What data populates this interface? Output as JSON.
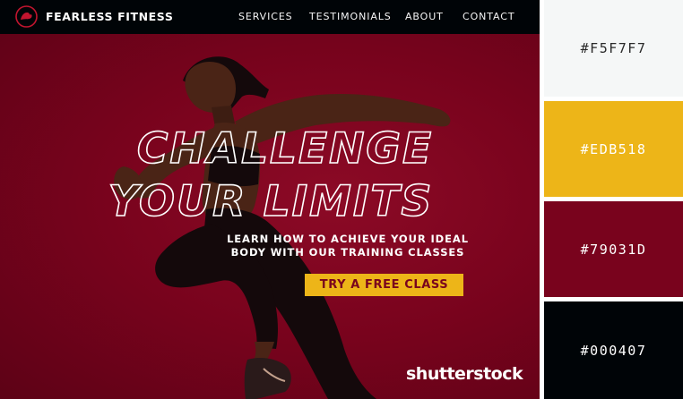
{
  "brand": {
    "name": "FEARLESS FITNESS"
  },
  "nav": {
    "items": [
      {
        "label": "SERVICES"
      },
      {
        "label": "TESTIMONIALS"
      },
      {
        "label": "ABOUT"
      },
      {
        "label": "CONTACT"
      }
    ]
  },
  "hero": {
    "title_line1": "CHALLENGE",
    "title_line2": "YOUR LIMITS",
    "subtitle_line1": "LEARN HOW TO ACHIEVE YOUR IDEAL",
    "subtitle_line2": "BODY WITH OUR TRAINING CLASSES",
    "cta_label": "TRY A FREE CLASS"
  },
  "watermark": "shutterstock",
  "palette": [
    {
      "hex": "#F5F7F7"
    },
    {
      "hex": "#EDB518"
    },
    {
      "hex": "#79031D"
    },
    {
      "hex": "#000407"
    }
  ],
  "icons": {
    "logo": "flexed-arm-logo-icon"
  }
}
